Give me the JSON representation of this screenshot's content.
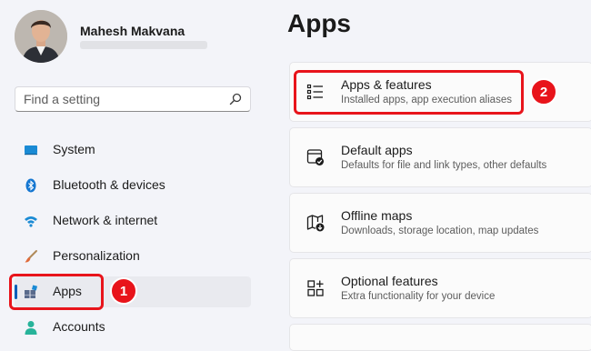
{
  "user": {
    "name": "Mahesh Makvana"
  },
  "search": {
    "placeholder": "Find a setting"
  },
  "sidebar": {
    "items": [
      {
        "label": "System",
        "icon": "monitor-icon"
      },
      {
        "label": "Bluetooth & devices",
        "icon": "bluetooth-icon"
      },
      {
        "label": "Network & internet",
        "icon": "wifi-icon"
      },
      {
        "label": "Personalization",
        "icon": "brush-icon"
      },
      {
        "label": "Apps",
        "icon": "apps-icon",
        "selected": true
      },
      {
        "label": "Accounts",
        "icon": "person-icon"
      }
    ]
  },
  "main": {
    "title": "Apps",
    "cards": [
      {
        "title": "Apps & features",
        "subtitle": "Installed apps, app execution aliases",
        "icon": "list-icon"
      },
      {
        "title": "Default apps",
        "subtitle": "Defaults for file and link types, other defaults",
        "icon": "default-apps-icon"
      },
      {
        "title": "Offline maps",
        "subtitle": "Downloads, storage location, map updates",
        "icon": "map-icon"
      },
      {
        "title": "Optional features",
        "subtitle": "Extra functionality for your device",
        "icon": "add-features-icon"
      }
    ]
  },
  "annotations": {
    "badge_1": "1",
    "badge_2": "2"
  },
  "colors": {
    "accent": "#005fb8",
    "callout_red": "#e8141b",
    "background": "#f3f4f9",
    "card": "#fbfbfb"
  }
}
